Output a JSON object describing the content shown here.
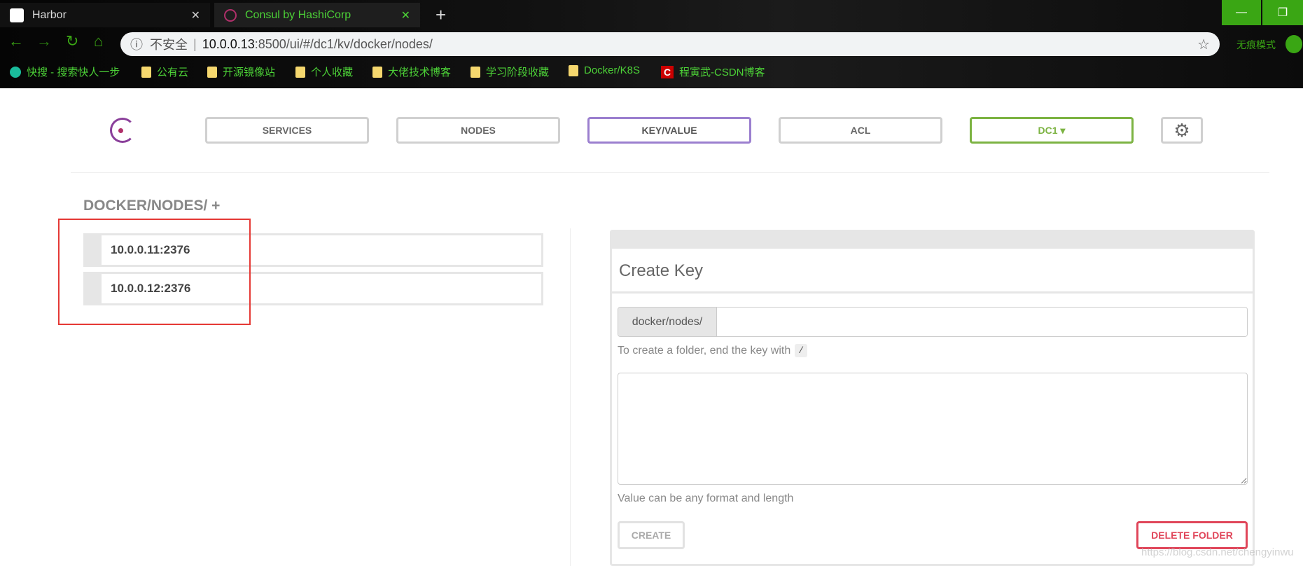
{
  "browser": {
    "tabs": [
      {
        "title": "Harbor"
      },
      {
        "title": "Consul by HashiCorp"
      }
    ],
    "new_tab": "+",
    "address": {
      "security": "不安全",
      "host": "10.0.0.13",
      "rest": ":8500/ui/#/dc1/kv/docker/nodes/"
    },
    "incognito": "无痕模式",
    "bookmarks": [
      "快搜 - 搜索快人一步",
      "公有云",
      "开源镜像站",
      "个人收藏",
      "大佬技术博客",
      "学习阶段收藏",
      "Docker/K8S",
      "程寅武-CSDN博客"
    ]
  },
  "nav": {
    "services": "SERVICES",
    "nodes": "NODES",
    "kv": "KEY/VALUE",
    "acl": "ACL",
    "dc": "DC1 ▾"
  },
  "colors": {
    "accent": "#9b7fcf",
    "dc": "#7cb342",
    "danger": "#e0465a",
    "annotation": "#e53935"
  },
  "kv": {
    "heading": "DOCKER/NODES/ +",
    "items": [
      "10.0.0.11:2376",
      "10.0.0.12:2376"
    ]
  },
  "create": {
    "title": "Create Key",
    "prefix": "docker/nodes/",
    "key_value": "",
    "help": "To create a folder, end the key with",
    "slash": "/",
    "value_help": "Value can be any format and length",
    "create_label": "CREATE",
    "delete_label": "DELETE FOLDER"
  },
  "watermark": "https://blog.csdn.net/chengyinwu"
}
